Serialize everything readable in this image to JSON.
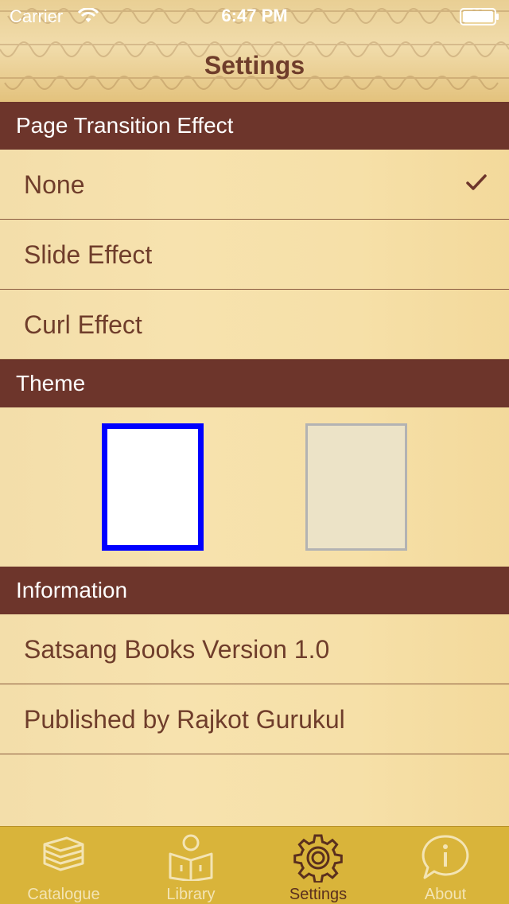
{
  "status_bar": {
    "carrier": "Carrier",
    "time": "6:47 PM"
  },
  "nav": {
    "title": "Settings"
  },
  "sections": {
    "transition": {
      "header": "Page Transition Effect",
      "options": [
        "None",
        "Slide Effect",
        "Curl Effect"
      ],
      "selected": "None"
    },
    "theme": {
      "header": "Theme",
      "swatches": [
        {
          "name": "white",
          "fill": "#ffffff",
          "selected": true
        },
        {
          "name": "cream",
          "fill": "#ece3c7",
          "selected": false
        }
      ],
      "selected_border_color": "#0000ff"
    },
    "information": {
      "header": "Information",
      "items": [
        "Satsang Books Version 1.0",
        "Published by Rajkot Gurukul"
      ]
    }
  },
  "tabbar": {
    "tabs": [
      {
        "label": "Catalogue",
        "icon": "books-icon",
        "active": false
      },
      {
        "label": "Library",
        "icon": "reader-icon",
        "active": false
      },
      {
        "label": "Settings",
        "icon": "gear-icon",
        "active": true
      },
      {
        "label": "About",
        "icon": "info-bubble-icon",
        "active": false
      }
    ]
  },
  "colors": {
    "header_bg": "#6d352b",
    "text": "#6f3d2b",
    "tabbar_bg": "#d9b43a",
    "row_bg": "#f5e0a8"
  }
}
